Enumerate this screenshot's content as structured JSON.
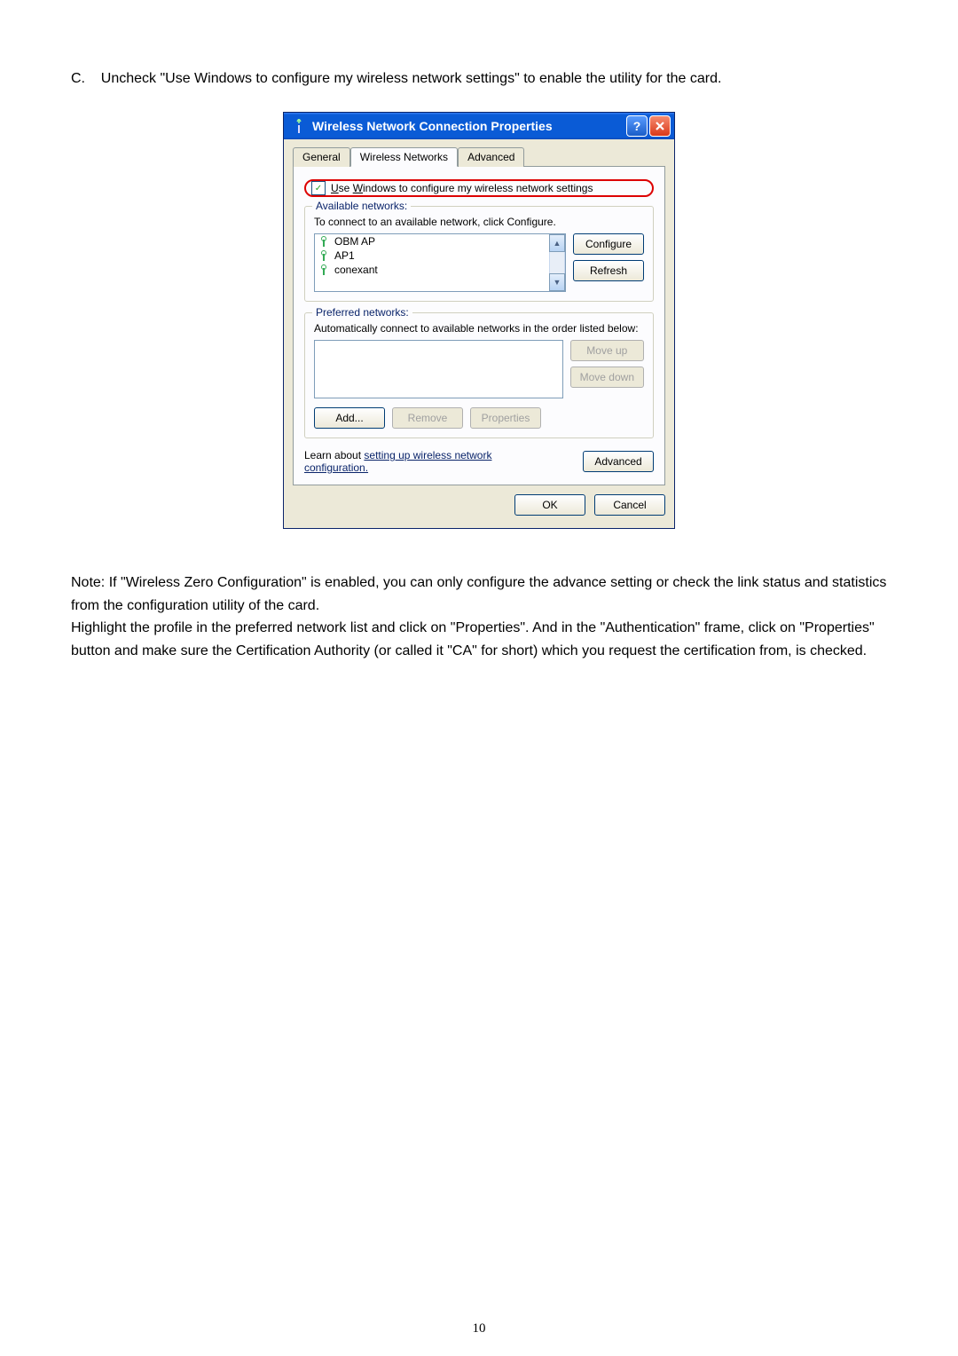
{
  "instruction": {
    "letter": "C.",
    "text": "Uncheck \"Use Windows to configure my wireless network settings\" to enable the utility for the card."
  },
  "dialog": {
    "title": "Wireless Network Connection Properties",
    "tabs": {
      "general": "General",
      "wireless": "Wireless Networks",
      "advanced": "Advanced"
    },
    "checkbox_label": "Use Windows to configure my wireless network settings",
    "checkbox_checked": "✓",
    "available": {
      "title": "Available networks:",
      "desc": "To connect to an available network, click Configure.",
      "items": [
        "OBM AP",
        "AP1",
        "conexant"
      ],
      "configure": "Configure",
      "refresh": "Refresh"
    },
    "preferred": {
      "title": "Preferred networks:",
      "desc": "Automatically connect to available networks in the order listed below:",
      "moveup": "Move up",
      "movedown": "Move down",
      "add": "Add...",
      "remove": "Remove",
      "properties": "Properties"
    },
    "learn": {
      "prefix": "Learn about ",
      "link": "setting up wireless network configuration.",
      "advanced": "Advanced"
    },
    "ok": "OK",
    "cancel": "Cancel"
  },
  "note": {
    "p1": "Note: If \"Wireless Zero Configuration\" is enabled, you can only configure the advance setting or check the link status and statistics from the configuration utility of the card.",
    "p2": "Highlight the profile in the preferred network list and click on \"Properties\". And in the \"Authentication\" frame, click on \"Properties\" button and make sure the Certification Authority (or called it \"CA\" for short) which you request the certification from, is checked."
  },
  "page_number": "10"
}
